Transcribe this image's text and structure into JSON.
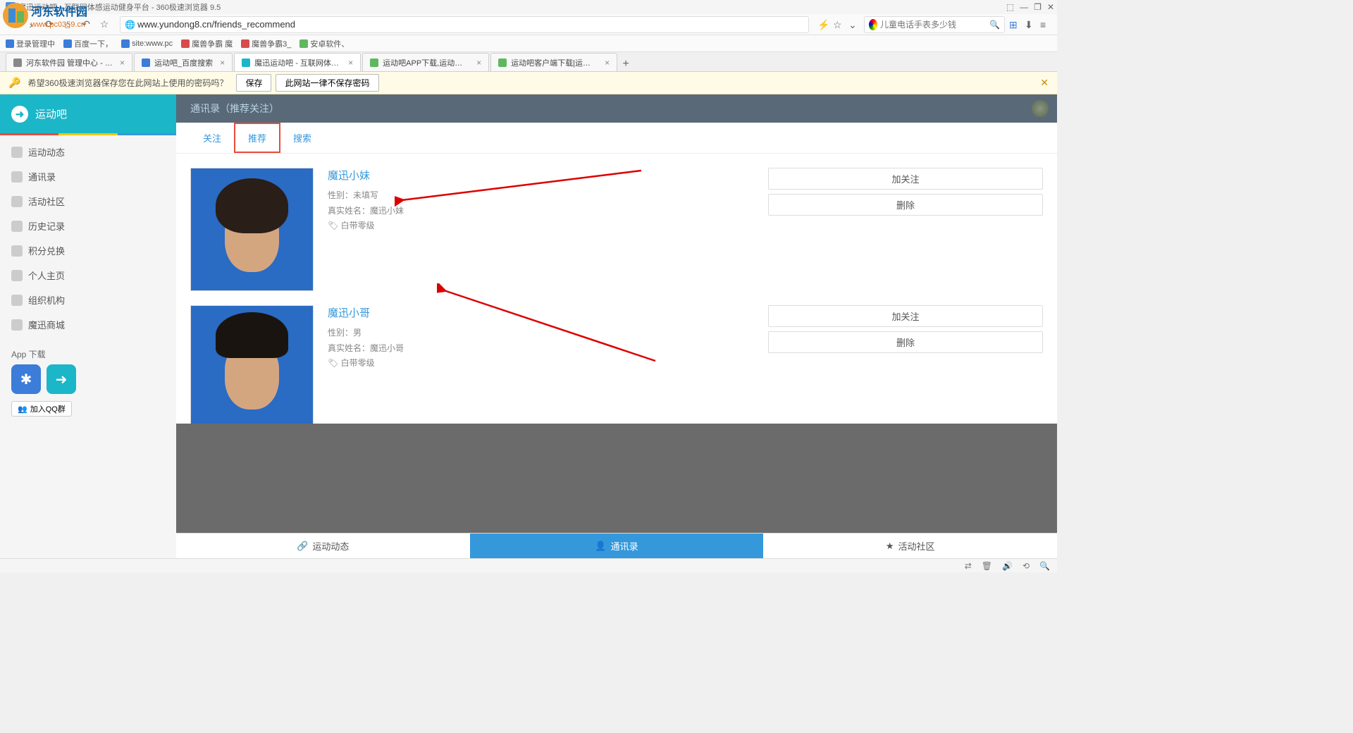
{
  "titlebar": {
    "title": "魔迅运动吧 - 互联网体感运动健身平台 - 360极速浏览器 9.5"
  },
  "url": "www.yundong8.cn/friends_recommend",
  "search_placeholder": "儿童电话手表多少钱",
  "bookmarks": [
    {
      "label": "登录管理中",
      "icon": "blue"
    },
    {
      "label": "百度一下，",
      "icon": "blue"
    },
    {
      "label": "site:www.pc",
      "icon": "blue"
    },
    {
      "label": "魔兽争霸 魔",
      "icon": "red"
    },
    {
      "label": "魔兽争霸3_",
      "icon": "red"
    },
    {
      "label": "安卓软件、",
      "icon": "green"
    }
  ],
  "tabs": [
    {
      "label": "河东软件园 管理中心 - Powere",
      "icon": "#888"
    },
    {
      "label": "运动吧_百度搜索",
      "icon": "#3b7dd8"
    },
    {
      "label": "魔迅运动吧 - 互联网体感运动健",
      "icon": "#1cb6c9",
      "active": true
    },
    {
      "label": "运动吧APP下载,运动吧官方客户",
      "icon": "#5fb85f"
    },
    {
      "label": "运动吧客户端下载|运动吧名师直",
      "icon": "#5fb85f"
    }
  ],
  "pwdbar": {
    "text": "希望360极速浏览器保存您在此网站上使用的密码吗？",
    "save": "保存",
    "never": "此网站一律不保存密码"
  },
  "sidebar": {
    "brand": "运动吧",
    "items": [
      "运动动态",
      "通讯录",
      "活动社区",
      "历史记录",
      "积分兑换",
      "个人主页",
      "组织机构",
      "魔迅商城"
    ],
    "app_section": "App 下载",
    "qq": "加入QQ群"
  },
  "content": {
    "header": "通讯录（推荐关注）",
    "tabs": [
      "关注",
      "推荐",
      "搜索"
    ],
    "active_tab": 1,
    "friends": [
      {
        "name": "魔迅小妹",
        "gender_label": "性别：",
        "gender": "未填写",
        "realname_label": "真实姓名：",
        "realname": "魔迅小妹",
        "level": "白带零级"
      },
      {
        "name": "魔迅小哥",
        "gender_label": "性别：",
        "gender": "男",
        "realname_label": "真实姓名：",
        "realname": "魔迅小哥",
        "level": "白带零级"
      }
    ],
    "actions": {
      "follow": "加关注",
      "remove": "删除"
    }
  },
  "bottom_nav": [
    {
      "label": "运动动态",
      "icon": "🔗"
    },
    {
      "label": "通讯录",
      "icon": "👤",
      "active": true
    },
    {
      "label": "活动社区",
      "icon": "★"
    }
  ],
  "logo_text_main": "河东软件园",
  "logo_text_sub": "www.pc0359.cn"
}
